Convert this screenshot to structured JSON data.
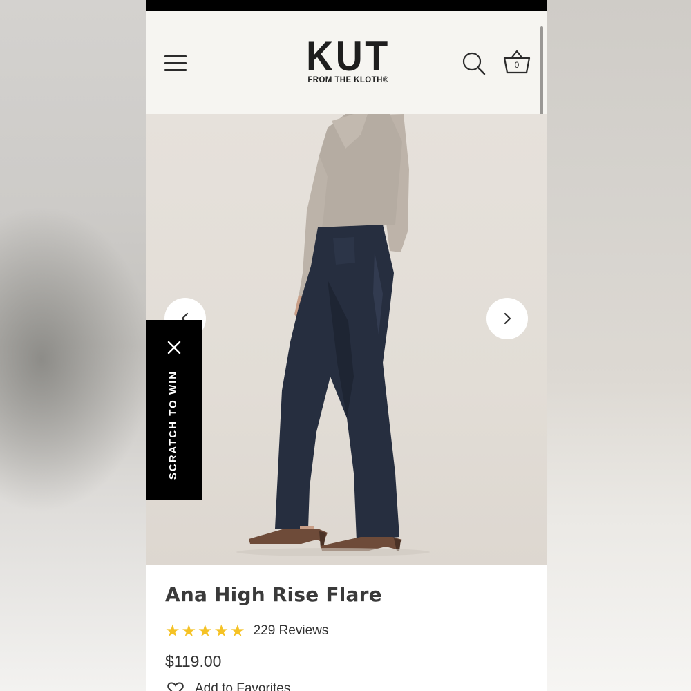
{
  "header": {
    "logo_main": "KUT",
    "logo_sub": "FROM THE KLOTH®",
    "cart_count": "0",
    "icons": {
      "menu": "hamburger-menu-icon",
      "search": "search-icon",
      "cart": "basket-icon"
    }
  },
  "hero": {
    "prev_icon": "chevron-left-icon",
    "next_icon": "chevron-right-icon"
  },
  "promo": {
    "label": "SCRATCH TO WIN",
    "close_icon": "close-icon"
  },
  "product": {
    "title": "Ana High Rise Flare",
    "rating_stars": 5,
    "reviews": "229 Reviews",
    "price": "$119.00",
    "favorites_label": "Add to Favorites"
  },
  "colors": {
    "star": "#f5c225",
    "header_bg": "#f6f5f1",
    "promo_bg": "#000000"
  }
}
